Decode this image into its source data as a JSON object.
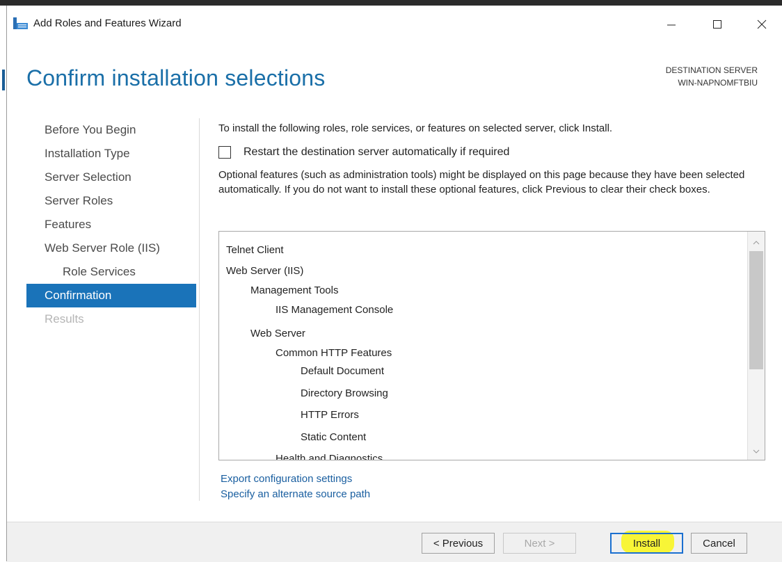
{
  "window": {
    "title": "Add Roles and Features Wizard",
    "minimize_glyph": "—",
    "maximize_glyph": "☐",
    "close_glyph": "✕"
  },
  "header": {
    "title": "Confirm installation selections",
    "destination_label": "DESTINATION SERVER",
    "destination_server": "WIN-NAPNOMFTBIU"
  },
  "nav": {
    "items": [
      {
        "label": "Before You Begin",
        "state": "normal"
      },
      {
        "label": "Installation Type",
        "state": "normal"
      },
      {
        "label": "Server Selection",
        "state": "normal"
      },
      {
        "label": "Server Roles",
        "state": "normal"
      },
      {
        "label": "Features",
        "state": "normal"
      },
      {
        "label": "Web Server Role (IIS)",
        "state": "normal"
      },
      {
        "label": "Role Services",
        "state": "normal"
      },
      {
        "label": "Confirmation",
        "state": "active"
      },
      {
        "label": "Results",
        "state": "disabled"
      }
    ]
  },
  "content": {
    "intro": "To install the following roles, role services, or features on selected server, click Install.",
    "restart_label": "Restart the destination server automatically if required",
    "restart_checked": false,
    "optional_text": "Optional features (such as administration tools) might be displayed on this page because they have been selected automatically. If you do not want to install these optional features, click Previous to clear their check boxes."
  },
  "selections": {
    "items": [
      "Telnet Client",
      "Web Server (IIS)",
      "Management Tools",
      "IIS Management Console",
      "Web Server",
      "Common HTTP Features",
      "Default Document",
      "Directory Browsing",
      "HTTP Errors",
      "Static Content",
      "Health and Diagnostics"
    ]
  },
  "links": {
    "export": "Export configuration settings",
    "alternate_source": "Specify an alternate source path"
  },
  "footer": {
    "previous": "< Previous",
    "next": "Next >",
    "install": "Install",
    "cancel": "Cancel"
  },
  "colors": {
    "accent": "#1a73b9",
    "title_blue": "#1a6fa8",
    "link_blue": "#1a5fa0",
    "highlight": "#f8f522"
  }
}
